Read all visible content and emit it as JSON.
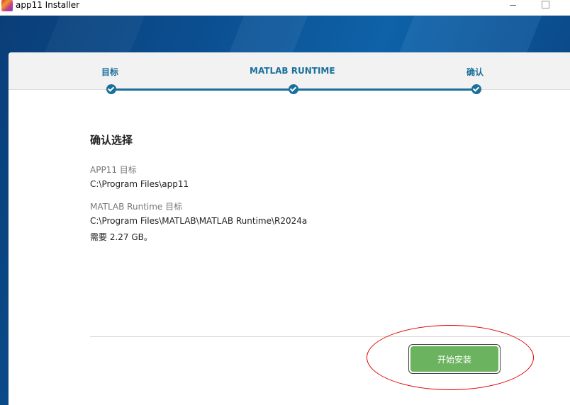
{
  "window": {
    "title": "app11 Installer",
    "icon": "app-icon"
  },
  "stepper": {
    "steps": [
      {
        "label": "目标",
        "state": "done"
      },
      {
        "label": "MATLAB RUNTIME",
        "state": "done"
      },
      {
        "label": "确认",
        "state": "done"
      }
    ],
    "accent_color": "#1a6f9c"
  },
  "confirm": {
    "heading": "确认选择",
    "app_label": "APP11 目标",
    "app_path": "C:\\Program Files\\app11",
    "runtime_label": "MATLAB Runtime 目标",
    "runtime_path": "C:\\Program Files\\MATLAB\\MATLAB Runtime\\R2024a",
    "requirement": "需要 2.27 GB。"
  },
  "actions": {
    "install_label": "开始安装",
    "install_color": "#6bb35f"
  },
  "annotation": {
    "highlight_color": "#e00000"
  }
}
